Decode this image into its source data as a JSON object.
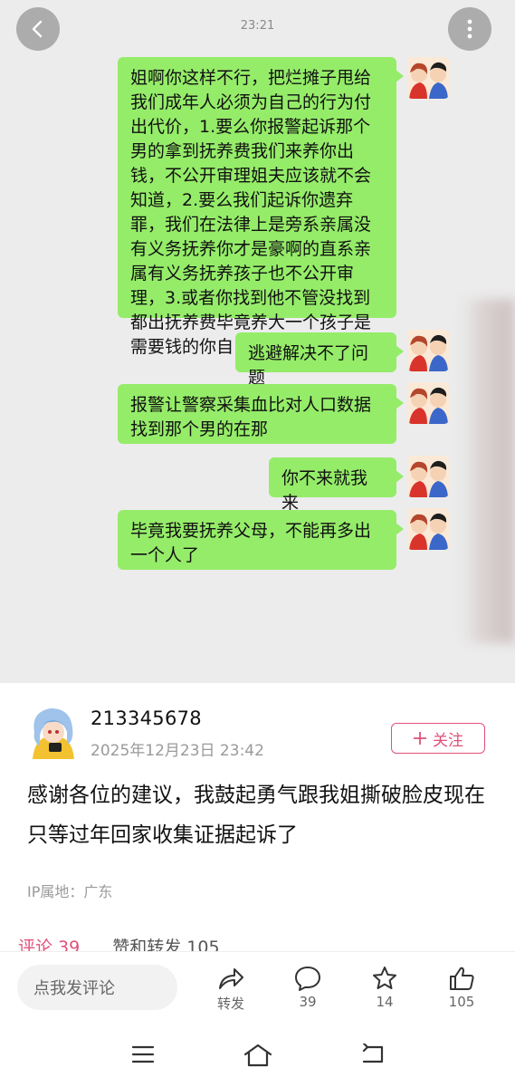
{
  "chat": {
    "time": "23:21",
    "messages": [
      {
        "text": "姐啊你这样不行，把烂摊子甩给我们成年人必须为自己的行为付出代价，1.要么你报警起诉那个男的拿到抚养费我们来养你出钱，不公开审理姐夫应该就不会知道，2.要么我们起诉你遗弃罪，我们在法律上是旁系亲属没有义务抚养你才是豪啊的直系亲属有义务抚养孩子也不公开审理，3.或者你找到他不管没找到都出抚养费毕竟养大一个孩子是需要钱的你自己清楚"
      },
      {
        "text": "逃避解决不了问题"
      },
      {
        "text": "报警让警察采集血比对人口数据找到那个男的在那"
      },
      {
        "text": "你不来就我来"
      },
      {
        "text": "毕竟我要抚养父母，不能再多出一个人了"
      }
    ]
  },
  "post": {
    "username": "213345678",
    "date": "2025年12月23日 23:42",
    "follow_label": "关注",
    "text": "感谢各位的建议，我鼓起勇气跟我姐撕破脸皮现在只等过年回家收集证据起诉了",
    "ip": "IP属地：广东",
    "tabs": {
      "comments": "评论 39",
      "likes": "赞和转发 105"
    }
  },
  "actions": {
    "comment_placeholder": "点我发评论",
    "repost_label": "转发",
    "comment_count": "39",
    "star_count": "14",
    "like_count": "105"
  },
  "colors": {
    "bubble": "#95ec69",
    "accent": "#e1507a"
  }
}
